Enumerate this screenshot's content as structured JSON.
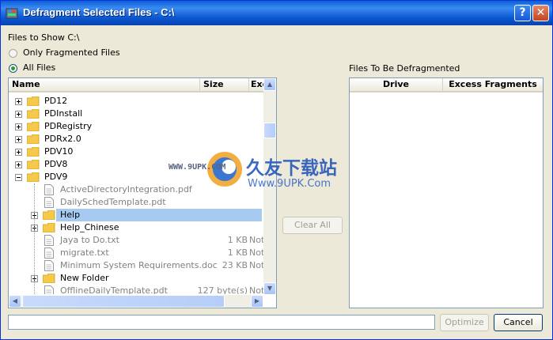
{
  "window": {
    "title": "Defragment Selected Files - C:\\",
    "help_label": "?",
    "close_label": "✕"
  },
  "filter": {
    "group_label": "Files to Show C:\\",
    "option_fragmented": "Only Fragmented Files",
    "option_all": "All Files",
    "selected": "All Files"
  },
  "file_tree": {
    "columns": [
      "Name",
      "Size",
      "Exc"
    ],
    "rows": [
      {
        "name": "PD12",
        "type": "folder",
        "level": 1,
        "expander": "+",
        "size": "",
        "excess": ""
      },
      {
        "name": "PDInstall",
        "type": "folder",
        "level": 1,
        "expander": "+",
        "size": "",
        "excess": ""
      },
      {
        "name": "PDRegistry",
        "type": "folder",
        "level": 1,
        "expander": "+",
        "size": "",
        "excess": ""
      },
      {
        "name": "PDRx2.0",
        "type": "folder",
        "level": 1,
        "expander": "+",
        "size": "",
        "excess": ""
      },
      {
        "name": "PDV10",
        "type": "folder",
        "level": 1,
        "expander": "+",
        "size": "",
        "excess": ""
      },
      {
        "name": "PDV8",
        "type": "folder",
        "level": 1,
        "expander": "+",
        "size": "",
        "excess": ""
      },
      {
        "name": "PDV9",
        "type": "folder",
        "level": 1,
        "expander": "-",
        "size": "",
        "excess": ""
      },
      {
        "name": "ActiveDirectoryIntegration.pdf",
        "type": "file",
        "level": 2,
        "expander": "",
        "size": "",
        "excess": ""
      },
      {
        "name": "DailySchedTemplate.pdt",
        "type": "file",
        "level": 2,
        "expander": "",
        "size": "",
        "excess": ""
      },
      {
        "name": "Help",
        "type": "folder",
        "level": 2,
        "expander": "+",
        "size": "",
        "excess": "",
        "selected": true
      },
      {
        "name": "Help_Chinese",
        "type": "folder",
        "level": 2,
        "expander": "+",
        "size": "",
        "excess": ""
      },
      {
        "name": "Jaya to Do.txt",
        "type": "file",
        "level": 2,
        "expander": "",
        "size": "1 KB",
        "excess": "Not"
      },
      {
        "name": "migrate.txt",
        "type": "file",
        "level": 2,
        "expander": "",
        "size": "1 KB",
        "excess": "Not"
      },
      {
        "name": "Minimum System Requirements.doc",
        "type": "file",
        "level": 2,
        "expander": "",
        "size": "23 KB",
        "excess": "Not"
      },
      {
        "name": "New Folder",
        "type": "folder",
        "level": 2,
        "expander": "+",
        "size": "",
        "excess": ""
      },
      {
        "name": "OfflineDailyTemplate.pdt",
        "type": "file",
        "level": 2,
        "expander": "",
        "size": "127 byte(s)",
        "excess": "Not"
      }
    ]
  },
  "defrag_list": {
    "label": "Files To Be Defragmented",
    "columns": [
      "Drive",
      "Excess Fragments"
    ]
  },
  "buttons": {
    "clear_all": "Clear All",
    "optimize": "Optimize",
    "cancel": "Cancel"
  },
  "watermark": {
    "site": "WWW.9UPK.COM",
    "brand": "久友下载站",
    "url": "Www.9UPK.Com"
  },
  "colors": {
    "titlebar": "#0a5fd8",
    "selection": "#a6caf0",
    "folder": "#f5c94a"
  }
}
